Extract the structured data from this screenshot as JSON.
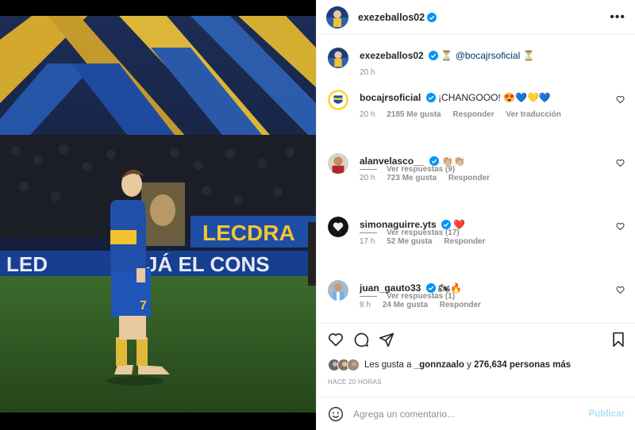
{
  "post": {
    "author": "exezeballos02",
    "caption_author": "exezeballos02",
    "caption_hourglass_1": "⏳",
    "caption_mention": "@bocajrsoficial",
    "caption_hourglass_2": "⏳",
    "caption_time": "20 h"
  },
  "comments": [
    {
      "user": "bocajrsoficial",
      "text": "¡CHANGOOO! 😍💙💛💙",
      "time": "20 h",
      "likes": "2185 Me gusta",
      "reply": "Responder",
      "translate": "Ver traducción",
      "replies": "Ver respuestas (9)"
    },
    {
      "user": "alanvelasco__",
      "text": "👏🏼👏🏼",
      "time": "20 h",
      "likes": "723 Me gusta",
      "reply": "Responder",
      "replies": "Ver respuestas (17)"
    },
    {
      "user": "simonaguirre.yts",
      "text": "❤️",
      "time": "17 h",
      "likes": "52 Me gusta",
      "reply": "Responder",
      "replies": "Ver respuestas (1)"
    },
    {
      "user": "juan_gauto33",
      "text": "🏍🔥",
      "time": "8 h",
      "likes": "24 Me gusta",
      "reply": "Responder"
    }
  ],
  "likes_line": {
    "prefix": "Les gusta a",
    "user": "_gonnzaalo",
    "connector": "y",
    "count": "276,634 personas más"
  },
  "timestamp": "HACE 20 HORAS",
  "composer": {
    "placeholder": "Agrega un comentario...",
    "publish": "Publicar"
  },
  "photo": {
    "banner_left": "LED",
    "banner_right": "JÁ EL CONS",
    "banner_upper": "LECDRA",
    "jersey_number": "7"
  },
  "colors": {
    "verified": "#0095f6",
    "link": "#00376b",
    "publish_disabled": "#b2dffc",
    "boca_blue": "#1f4fa8",
    "boca_yellow": "#f2c230"
  }
}
